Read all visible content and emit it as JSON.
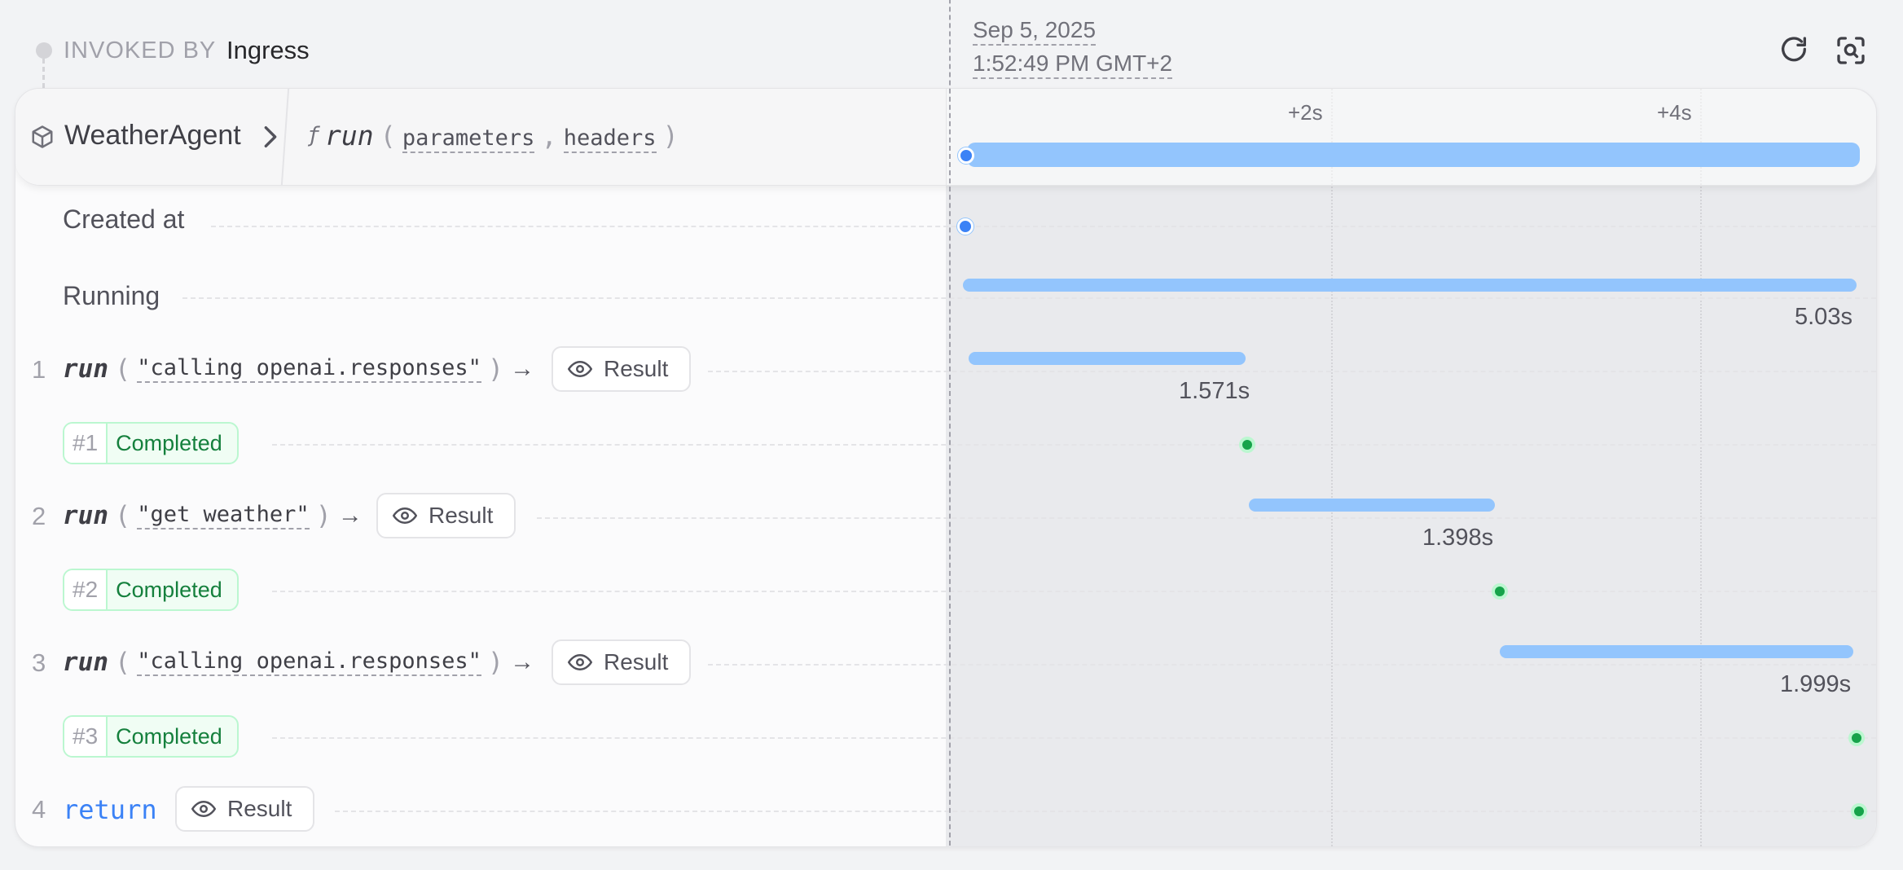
{
  "header": {
    "invoked_label": "INVOKED BY",
    "invoked_value": "Ingress",
    "date": "Sep 5, 2025",
    "time": "1:52:49 PM GMT+2",
    "icons": [
      "refresh-icon",
      "focus-icon"
    ]
  },
  "function": {
    "service": "WeatherAgent",
    "f_symbol": "ƒ",
    "handler": "run",
    "open_paren": "(",
    "params": [
      "parameters",
      "headers"
    ],
    "comma": ",",
    "close_paren": ")"
  },
  "timeline": {
    "ticks": [
      "+2s",
      "+4s"
    ]
  },
  "rows": {
    "created_at": "Created at",
    "running": "Running",
    "running_duration": "5.03s"
  },
  "steps": [
    {
      "index": "1",
      "keyword": "run",
      "arg": "\"calling openai.responses\"",
      "arrow": "→",
      "result_label": "Result",
      "duration": "1.571s",
      "attempt": "#1",
      "status": "Completed"
    },
    {
      "index": "2",
      "keyword": "run",
      "arg": "\"get weather\"",
      "arrow": "→",
      "result_label": "Result",
      "duration": "1.398s",
      "attempt": "#2",
      "status": "Completed"
    },
    {
      "index": "3",
      "keyword": "run",
      "arg": "\"calling openai.responses\"",
      "arrow": "→",
      "result_label": "Result",
      "duration": "1.999s",
      "attempt": "#3",
      "status": "Completed"
    }
  ],
  "return_step": {
    "index": "4",
    "keyword": "return",
    "result_label": "Result"
  },
  "colors": {
    "bar": "#93c5fd",
    "accent": "#3b82f6",
    "success": "#16a34a"
  }
}
